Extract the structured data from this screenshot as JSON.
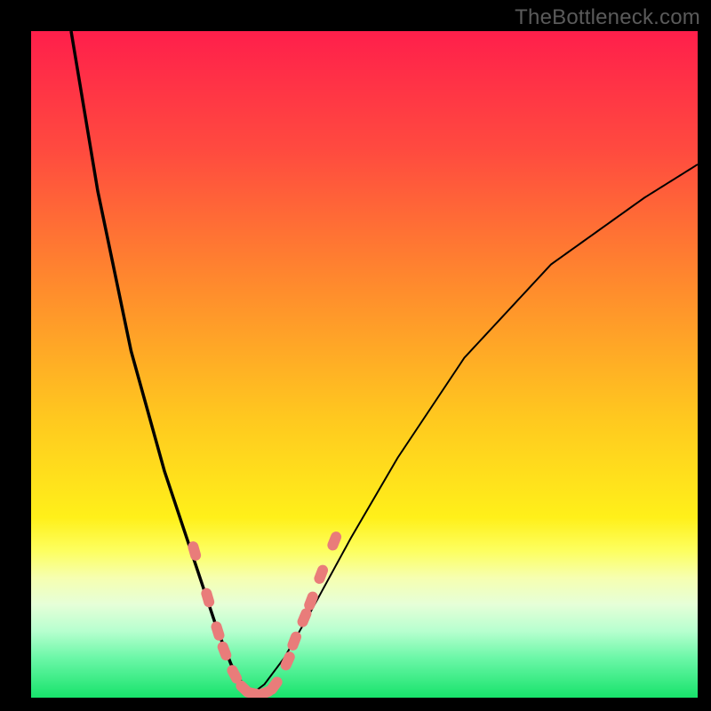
{
  "attribution": "TheBottleneck.com",
  "chart_data": {
    "type": "line",
    "title": "",
    "xlabel": "",
    "ylabel": "",
    "xlim": [
      0,
      100
    ],
    "ylim": [
      0,
      100
    ],
    "note": "A bottleneck-style V curve plotted over a vertical red→yellow→green gradient. Two smooth black curves descend from the top edges and meet near x≈33 at the bottom (green) band. Salmon capsule-shaped markers sit along the lower portions of both arms near the minimum. Axis tick labels are not rendered in the source image, so numeric values below are approximate positions in 0–100 plot-fraction space.",
    "series": [
      {
        "name": "left-arm",
        "x": [
          6,
          10,
          15,
          20,
          25,
          28,
          30,
          32,
          33
        ],
        "y": [
          100,
          76,
          52,
          34,
          19,
          10,
          5,
          1.5,
          0.5
        ]
      },
      {
        "name": "right-arm",
        "x": [
          33,
          35,
          38,
          42,
          48,
          55,
          65,
          78,
          92,
          100
        ],
        "y": [
          0.5,
          2,
          6,
          13,
          24,
          36,
          51,
          65,
          75,
          80
        ]
      }
    ],
    "markers": {
      "description": "salmon rounded-rect dash markers along the low portion of both arms",
      "points": [
        {
          "x": 24.5,
          "y": 22
        },
        {
          "x": 26.5,
          "y": 15
        },
        {
          "x": 28.0,
          "y": 10
        },
        {
          "x": 29.0,
          "y": 7
        },
        {
          "x": 30.5,
          "y": 3.5
        },
        {
          "x": 32.0,
          "y": 1.3
        },
        {
          "x": 33.5,
          "y": 0.6
        },
        {
          "x": 35.0,
          "y": 0.7
        },
        {
          "x": 36.5,
          "y": 1.8
        },
        {
          "x": 38.5,
          "y": 5.5
        },
        {
          "x": 39.5,
          "y": 8.5
        },
        {
          "x": 41.0,
          "y": 12.0
        },
        {
          "x": 42.0,
          "y": 14.5
        },
        {
          "x": 43.5,
          "y": 18.5
        },
        {
          "x": 45.5,
          "y": 23.5
        }
      ]
    },
    "gradient_stops": [
      {
        "pct": 0,
        "color": "#ff1f4b"
      },
      {
        "pct": 18,
        "color": "#ff4b3f"
      },
      {
        "pct": 38,
        "color": "#ff8a2d"
      },
      {
        "pct": 58,
        "color": "#ffc81f"
      },
      {
        "pct": 73,
        "color": "#fff01a"
      },
      {
        "pct": 78,
        "color": "#fdff60"
      },
      {
        "pct": 82,
        "color": "#f6ffb0"
      },
      {
        "pct": 86,
        "color": "#e6ffd8"
      },
      {
        "pct": 90,
        "color": "#b7ffcf"
      },
      {
        "pct": 94,
        "color": "#6cf7a8"
      },
      {
        "pct": 100,
        "color": "#17e36b"
      }
    ]
  }
}
